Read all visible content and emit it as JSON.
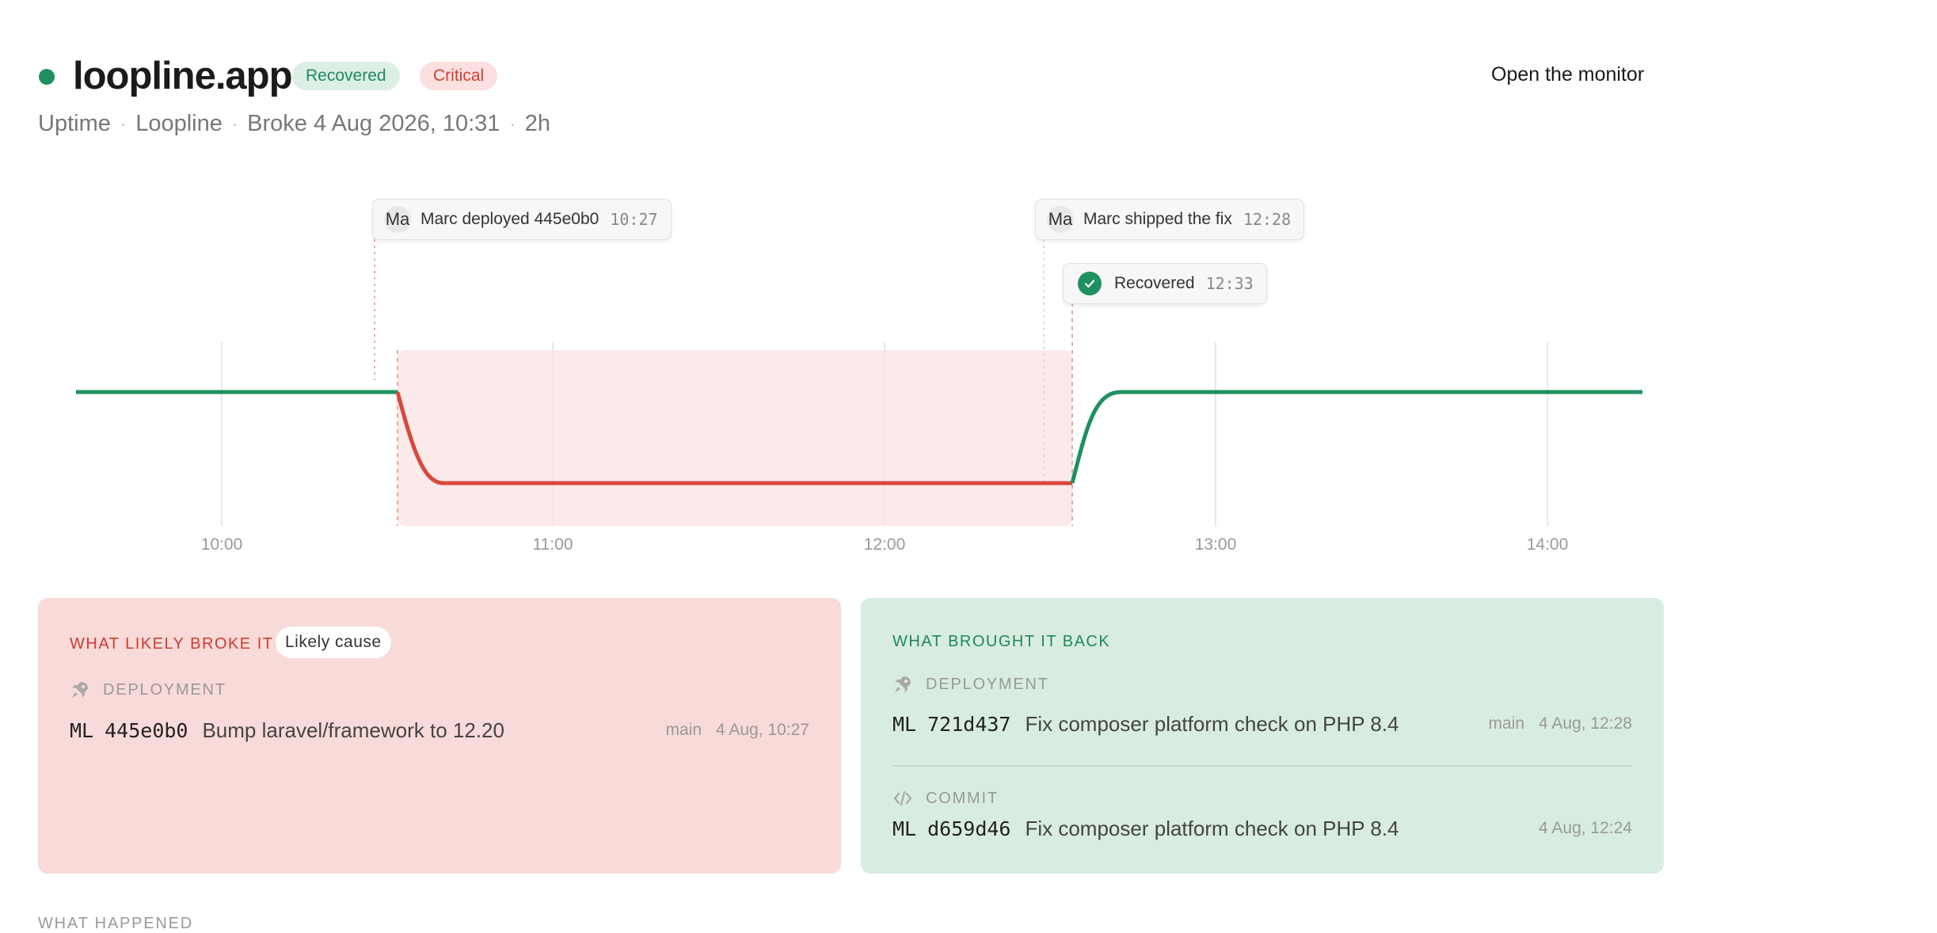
{
  "header": {
    "title": "loopline.app",
    "badge_recovered": "Recovered",
    "badge_critical": "Critical",
    "open_monitor": "Open the monitor",
    "meta": [
      "Uptime",
      "Loopline",
      "Broke 4 Aug 2026, 10:31",
      "2h"
    ],
    "status_color": "#1f9060"
  },
  "timeline": {
    "tick_labels": [
      "10:00",
      "11:00",
      "12:00",
      "13:00",
      "14:00"
    ],
    "markers": {
      "deploy": {
        "avatar": "Ma",
        "text": "Marc deployed 445e0b0",
        "time": "10:27"
      },
      "fix": {
        "avatar": "Ma",
        "text": "Marc shipped the fix",
        "time": "12:28"
      },
      "recovered": {
        "text": "Recovered",
        "time": "12:33"
      }
    },
    "colors": {
      "up": "#1f9060",
      "down": "#d9473c",
      "incident_bg": "#fbeae9"
    }
  },
  "broke": {
    "title": "WHAT LIKELY BROKE IT",
    "badge": "Likely cause",
    "section": {
      "icon": "rocket-icon",
      "label": "DEPLOYMENT"
    },
    "item": {
      "initials": "ML",
      "sha": "445e0b0",
      "message": "Bump laravel/framework to 12.20",
      "branch": "main",
      "date": "4 Aug, 10:27"
    }
  },
  "back": {
    "title": "WHAT BROUGHT IT BACK",
    "deployment": {
      "icon": "rocket-icon",
      "label": "DEPLOYMENT",
      "item": {
        "initials": "ML",
        "sha": "721d437",
        "message": "Fix composer platform check on PHP 8.4",
        "branch": "main",
        "date": "4 Aug, 12:28"
      }
    },
    "commit": {
      "icon": "code-icon",
      "label": "COMMIT",
      "item": {
        "initials": "ML",
        "sha": "d659d46",
        "message": "Fix composer platform check on PHP 8.4",
        "date": "4 Aug, 12:24"
      }
    }
  },
  "footer": {
    "what_happened": "WHAT HAPPENED"
  }
}
